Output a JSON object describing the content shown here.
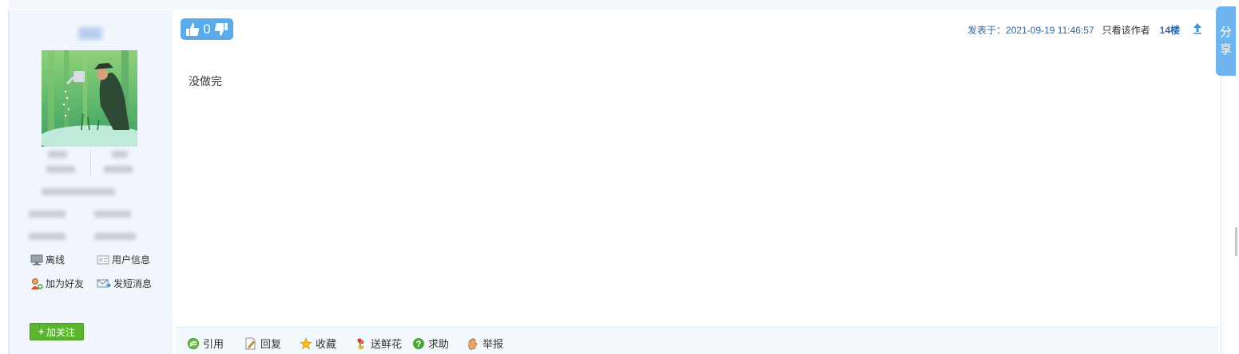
{
  "post": {
    "vote_count": "0",
    "posted_label": "发表于：",
    "posted_time": "2021-09-19 11:46:57",
    "only_author_label": "只看该作者",
    "floor_label": "14楼",
    "content": "没做完"
  },
  "user": {
    "status_label": "离线",
    "profile_label": "用户信息",
    "add_friend_label": "加为好友",
    "message_label": "发短消息",
    "follow_label": "加关注",
    "follow_plus": "+"
  },
  "actions": [
    {
      "label": "引用",
      "icon": "quote-icon"
    },
    {
      "label": "回复",
      "icon": "reply-icon"
    },
    {
      "label": "收藏",
      "icon": "star-icon"
    },
    {
      "label": "送鲜花",
      "icon": "flower-icon"
    },
    {
      "label": "求助",
      "icon": "help-icon"
    },
    {
      "label": "举报",
      "icon": "report-hand-icon"
    }
  ],
  "share": {
    "line1": "分",
    "line2": "享"
  },
  "colors": {
    "accent": "#5aabeb",
    "link_blue": "#2a6aa8",
    "follow_green": "#5cb531",
    "sidebar_bg": "#f0f6fc"
  }
}
